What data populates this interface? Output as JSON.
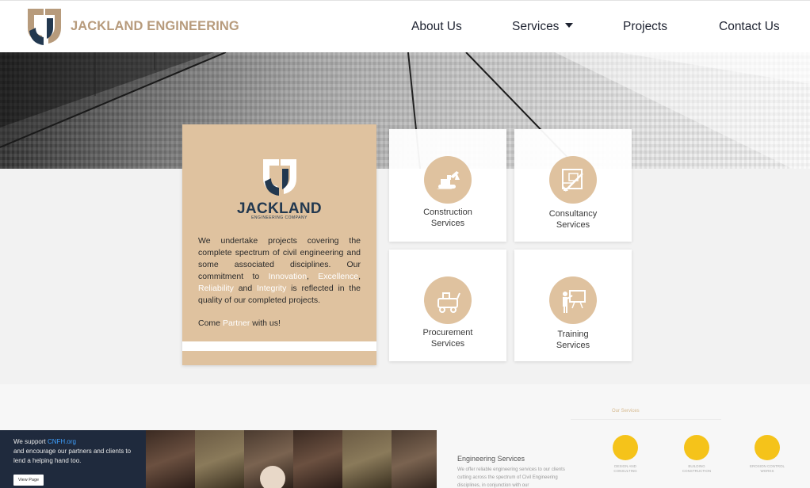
{
  "navbar": {
    "brand": "JACKLAND ENGINEERING",
    "links": [
      {
        "label": "About Us"
      },
      {
        "label": "Services"
      },
      {
        "label": "Projects"
      },
      {
        "label": "Contact Us"
      }
    ]
  },
  "colors": {
    "brand_tan": "#dfc29f",
    "brand_text": "#b79b7c",
    "navy": "#22384f",
    "accent_yellow": "#f5c31a"
  },
  "intro": {
    "name": "JACKLAND",
    "subtitle": "ENGINEERING COMPANY",
    "text_1": "We undertake projects covering the complete spectrum of civil engineering and some associated disciplines. Our commitment to ",
    "word_innovation": "Innovation",
    "sep_1": ", ",
    "word_excellence": "Excellence",
    "sep_2": ", ",
    "word_reliability": "Reliability",
    "sep_3": " and ",
    "word_integrity": "Integrity",
    "text_2": " is reflected in the quality of our completed projects.",
    "cta_prefix": "Come ",
    "cta_word": "Partner",
    "cta_suffix": " with us!"
  },
  "services": [
    {
      "line1": "Construction",
      "line2": "Services",
      "icon": "excavator-icon"
    },
    {
      "line1": "Consultancy",
      "line2": "Services",
      "icon": "blueprint-icon"
    },
    {
      "line1": "Procurement",
      "line2": "Services",
      "icon": "cart-icon"
    },
    {
      "line1": "Training",
      "line2": "Services",
      "icon": "presentation-icon"
    }
  ],
  "promo": {
    "prefix": "We support ",
    "link": "CNFH.org",
    "text": "and encourage our partners and clients to lend a helping hand too.",
    "button": "View Page"
  },
  "lower": {
    "our_services": "Our Services",
    "eng_title": "Engineering Services",
    "eng_text": "We offer reliable engineering services to our clients cutting across the spectrum of Civil Engineering disciplines, in conjunction with our",
    "mini_services": [
      {
        "label_1": "DESIGN AND",
        "label_2": "CONSULTING"
      },
      {
        "label_1": "BUILDING",
        "label_2": "CONSTRUCTION"
      },
      {
        "label_1": "EROSION CONTROL",
        "label_2": "WORKS"
      }
    ]
  }
}
